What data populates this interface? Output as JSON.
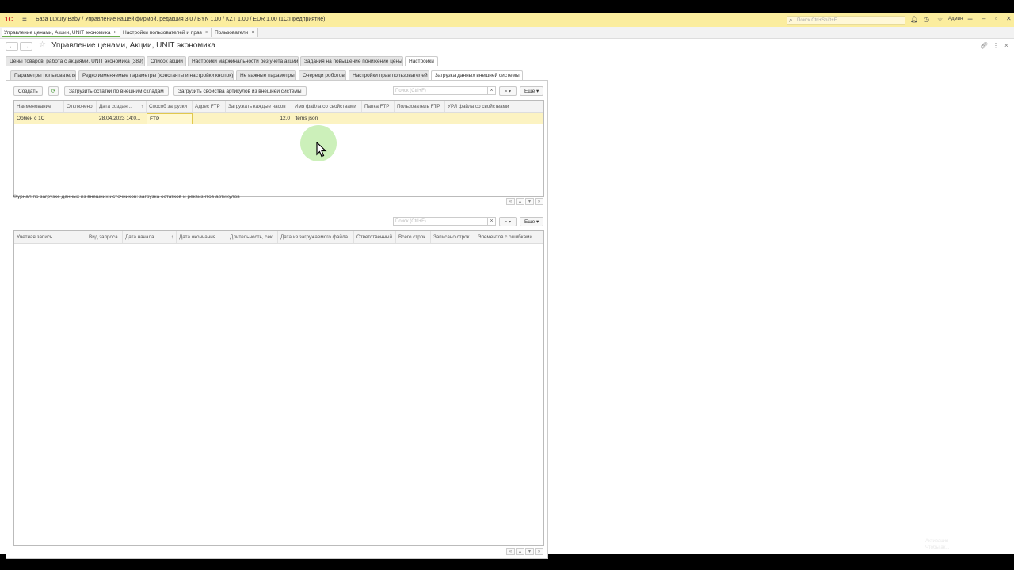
{
  "window": {
    "title": "База Luxury Baby / Управление нашей фирмой, редакция 3.0 / BYN 1,00 / KZT 1,00 / EUR 1,00  (1С:Предприятие)",
    "search_placeholder": "Поиск Ctrl+Shift+F",
    "user": "Админ"
  },
  "open_tabs": [
    {
      "label": "Управление ценами, Акции, UNIT экономика"
    },
    {
      "label": "Настройки пользователей и прав"
    },
    {
      "label": "Пользователи"
    }
  ],
  "form": {
    "title": "Управление ценами, Акции, UNIT экономика"
  },
  "main_tabs": [
    {
      "label": "Цены товаров, работа с акциями, UNIT экономика (389)"
    },
    {
      "label": "Список акции"
    },
    {
      "label": "Настройки маржинальности без учета акций"
    },
    {
      "label": "Задания на повышение понижение цены"
    },
    {
      "label": "Настройки"
    }
  ],
  "sub_tabs": [
    {
      "label": "Параметры пользователя"
    },
    {
      "label": "Редко изменяемые параметры (константы и настройки кнопок)"
    },
    {
      "label": "Не важные параметры"
    },
    {
      "label": "Очереди роботов"
    },
    {
      "label": "Настройки прав пользователей"
    },
    {
      "label": "Загрузка данных внешней системы"
    }
  ],
  "toolbar1": {
    "create": "Создать",
    "load_stock": "Загрузить остатки по внешним складам",
    "load_props": "Загрузить свойства артикулов из внешней системы",
    "search_placeholder": "Поиск (Ctrl+F)",
    "more": "Еще"
  },
  "grid1": {
    "columns": [
      "Наименование",
      "Отключено",
      "Дата создан...",
      "Способ загрузки",
      "Адрес FTP",
      "Загружать каждые часов",
      "Имя файла со свойствами",
      "Папка FTP",
      "Пользователь FTP",
      "УРЛ файла со свойствами"
    ],
    "rows": [
      {
        "name": "Обмен с 1С",
        "disabled": "",
        "date": "28.04.2023 14:0...",
        "method": "FTP",
        "ftp": "",
        "hours": "12.0",
        "file": "items json",
        "folder": "",
        "user": "",
        "url": ""
      }
    ]
  },
  "journal": {
    "caption": "Журнал по загрузке данных из внешних источников: загрузка остатков и реквизитов артикулов",
    "search_placeholder": "Поиск (Ctrl+F)",
    "more": "Еще"
  },
  "grid2": {
    "columns": [
      "Учетная запись",
      "Вид запроса",
      "Дата начала",
      "Дата окончания",
      "Длительность, сек",
      "Дата из загружаемого файла",
      "Ответственный",
      "Всего строк",
      "Записано строк",
      "Элементов с ошибками"
    ]
  },
  "watermark": [
    "Активация",
    "Чтобы ак..."
  ]
}
